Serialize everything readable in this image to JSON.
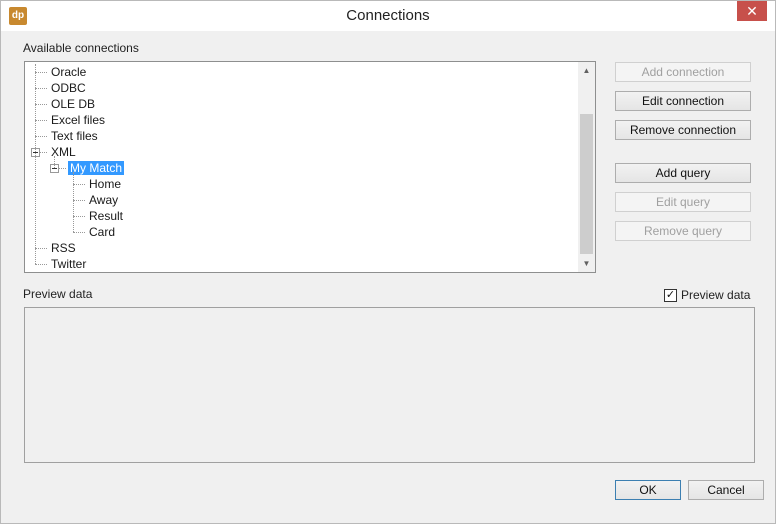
{
  "window": {
    "title": "Connections",
    "app_icon_text": "dp",
    "close_glyph": "✕"
  },
  "available_connections": {
    "label": "Available connections",
    "tree": {
      "items": [
        {
          "label": "Oracle",
          "level": 0,
          "expanded": false,
          "selected": false
        },
        {
          "label": "ODBC",
          "level": 0,
          "expanded": false,
          "selected": false
        },
        {
          "label": "OLE DB",
          "level": 0,
          "expanded": false,
          "selected": false
        },
        {
          "label": "Excel files",
          "level": 0,
          "expanded": false,
          "selected": false
        },
        {
          "label": "Text files",
          "level": 0,
          "expanded": false,
          "selected": false
        },
        {
          "label": "XML",
          "level": 0,
          "expanded": true,
          "selected": false
        },
        {
          "label": "My Match",
          "level": 1,
          "expanded": true,
          "selected": true
        },
        {
          "label": "Home",
          "level": 2,
          "expanded": false,
          "selected": false
        },
        {
          "label": "Away",
          "level": 2,
          "expanded": false,
          "selected": false
        },
        {
          "label": "Result",
          "level": 2,
          "expanded": false,
          "selected": false
        },
        {
          "label": "Card",
          "level": 2,
          "expanded": false,
          "selected": false
        },
        {
          "label": "RSS",
          "level": 0,
          "expanded": false,
          "selected": false
        },
        {
          "label": "Twitter",
          "level": 0,
          "expanded": false,
          "selected": false
        }
      ]
    },
    "scroll_up_glyph": "▲",
    "scroll_down_glyph": "▼"
  },
  "buttons": {
    "add_connection": {
      "label": "Add connection",
      "enabled": false
    },
    "edit_connection": {
      "label": "Edit connection",
      "enabled": true
    },
    "remove_connection": {
      "label": "Remove connection",
      "enabled": true
    },
    "add_query": {
      "label": "Add query",
      "enabled": true
    },
    "edit_query": {
      "label": "Edit query",
      "enabled": false
    },
    "remove_query": {
      "label": "Remove query",
      "enabled": false
    }
  },
  "preview": {
    "label": "Preview data",
    "checkbox_label": "Preview data",
    "checkbox_checked": true,
    "check_glyph": "✓"
  },
  "footer": {
    "ok_label": "OK",
    "cancel_label": "Cancel"
  }
}
